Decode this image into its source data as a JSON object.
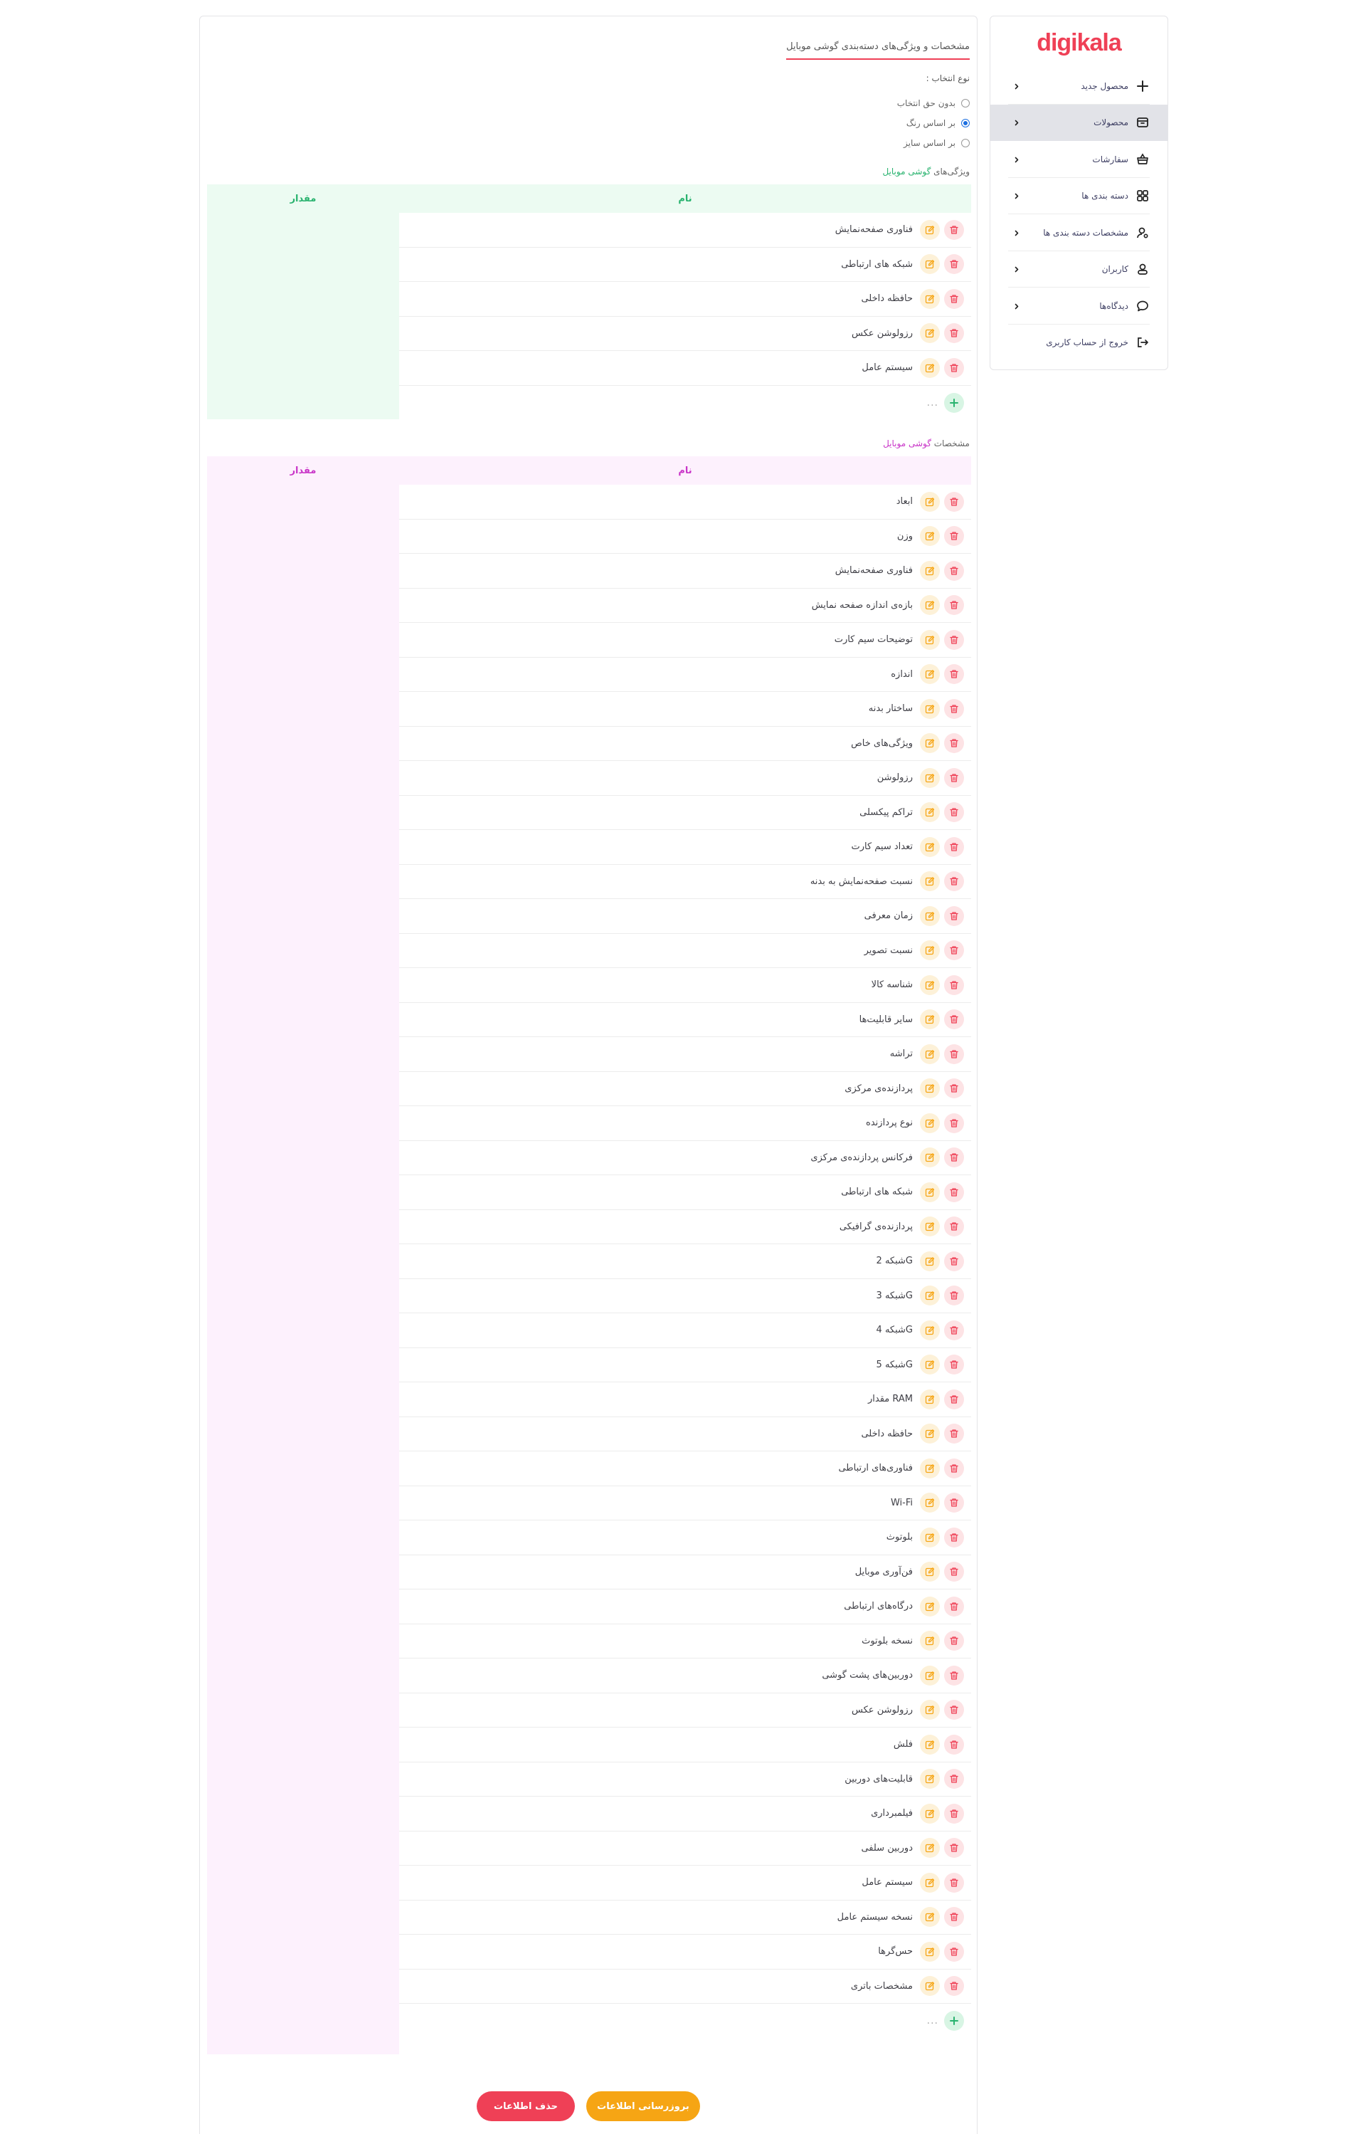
{
  "brand": {
    "logo_text": "digikala",
    "primary_color": "#ef4056"
  },
  "page": {
    "title": "مشخصات و ویژگی‌های دسته‌بندی گوشی موبایل",
    "selection_type_label": "نوع انتخاب :",
    "selection_options": [
      {
        "label": "بدون حق انتخاب",
        "selected": false
      },
      {
        "label": "بر اساس رنگ",
        "selected": true
      },
      {
        "label": "بر اساس سایز",
        "selected": false
      }
    ]
  },
  "features_section": {
    "title_prefix": "ویژگی‌های",
    "title_accent": "گوشی موبایل",
    "header_name": "نام",
    "header_value": "مقدار",
    "accent_color": "#29b36f",
    "rows": [
      "فناوری صفحه‌نمایش",
      "شبکه های ارتباطی",
      "حافظه داخلی",
      "رزولوشن عکس",
      "سیستم عامل"
    ],
    "add_placeholder": "..."
  },
  "specs_section": {
    "title_prefix": "مشخصات",
    "title_accent": "گوشی موبایل",
    "header_name": "نام",
    "header_value": "مقدار",
    "accent_color": "#c936c8",
    "rows": [
      "ابعاد",
      "وزن",
      "فناوری صفحه‌نمایش",
      "بازه‌ی اندازه صفحه نمایش",
      "توضیحات سیم کارت",
      "اندازه",
      "ساختار بدنه",
      "ویژگی‌های خاص",
      "رزولوشن",
      "تراکم پیکسلی",
      "تعداد سیم کارت",
      "نسبت صفحه‌نمایش به بدنه",
      "زمان معرفی",
      "نسبت تصویر",
      "شناسه کالا",
      "سایر قابلیت‌ها",
      "تراشه",
      "پردازنده‌ی مرکزی",
      "نوع پردازنده",
      "فرکانس پردازنده‌ی مرکزی",
      "شبکه های ارتباطی",
      "پردازنده‌ی گرافیکی",
      "شبکه 2G",
      "شبکه 3G",
      "شبکه 4G",
      "شبکه 5G",
      "مقدار RAM",
      "حافظه داخلی",
      "فناوری‌های ارتباطی",
      "Wi-Fi",
      "بلوتوث",
      "فن‌آوری موبایل",
      "درگاه‌های ارتباطی",
      "نسخه بلوتوث",
      "دوربین‌های پشت گوشی",
      "رزولوشن عکس",
      "فلش",
      "قابلیت‌های دوربین",
      "فیلمبرداری",
      "دوربین سلفی",
      "سیستم عامل",
      "نسخه سیستم عامل",
      "حس‌گرها",
      "مشخصات باتری"
    ],
    "add_placeholder": "..."
  },
  "actions": {
    "update_label": "بروزرسانی اطلاعات",
    "delete_label": "حذف اطلاعات"
  },
  "sidebar": {
    "items": [
      {
        "label": "محصول جدید",
        "icon": "plus-icon",
        "active": false
      },
      {
        "label": "محصولات",
        "icon": "box-icon",
        "active": true
      },
      {
        "label": "سفارشات",
        "icon": "basket-icon",
        "active": false
      },
      {
        "label": "دسته بندی ها",
        "icon": "grid-icon",
        "active": false
      },
      {
        "label": "مشخصات دسته بندی ها",
        "icon": "user-settings-icon",
        "active": false
      },
      {
        "label": "کاربران",
        "icon": "users-icon",
        "active": false
      },
      {
        "label": "دیدگاه‌ها",
        "icon": "comment-icon",
        "active": false
      },
      {
        "label": "خروج از حساب کاربری",
        "icon": "logout-icon",
        "active": false
      }
    ]
  }
}
